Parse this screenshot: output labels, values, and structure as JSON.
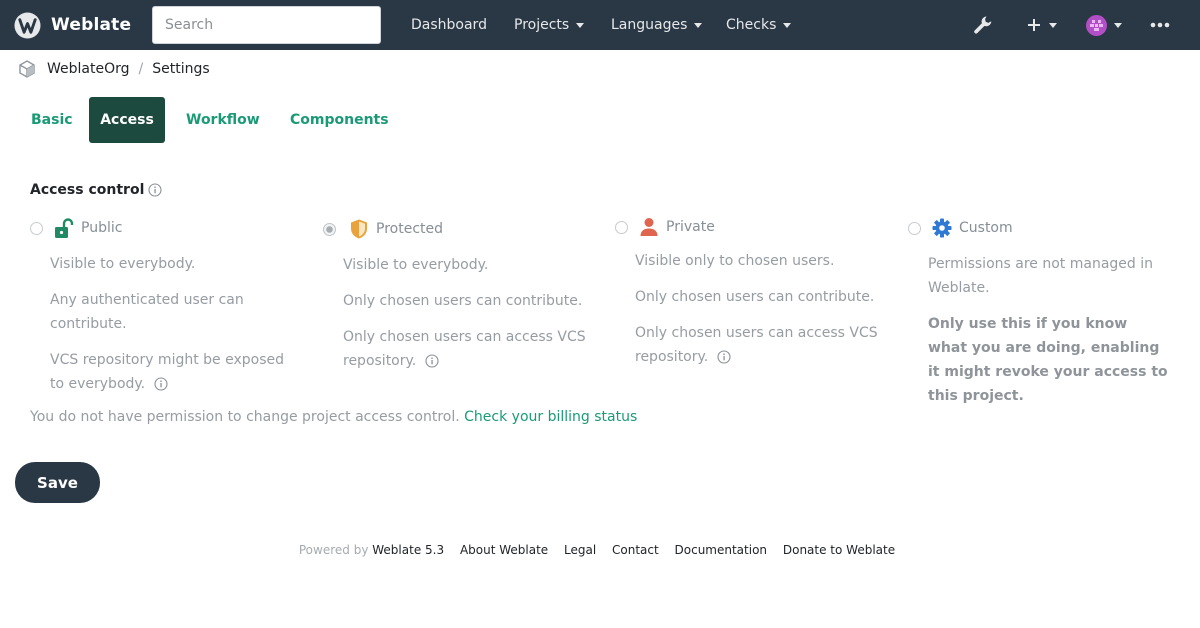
{
  "app": {
    "name": "Weblate"
  },
  "search": {
    "placeholder": "Search"
  },
  "nav": {
    "dashboard": "Dashboard",
    "projects": "Projects",
    "languages": "Languages",
    "checks": "Checks",
    "icons": {
      "tools": "wrench-icon",
      "add": "plus-icon",
      "user": "avatar-icon",
      "more": "ellipsis-icon"
    }
  },
  "breadcrumb": {
    "org": "WeblateOrg",
    "sep": "/",
    "page": "Settings"
  },
  "tabs": [
    {
      "label": "Basic",
      "active": false
    },
    {
      "label": "Access",
      "active": true
    },
    {
      "label": "Workflow",
      "active": false
    },
    {
      "label": "Components",
      "active": false
    }
  ],
  "access": {
    "title": "Access control",
    "options": [
      {
        "label": "Public",
        "icon": "unlocked-icon",
        "checked": false,
        "lines": [
          "Visible to everybody.",
          "Any authenticated user can contribute.",
          "VCS repository might be exposed to everybody."
        ]
      },
      {
        "label": "Protected",
        "icon": "shield-icon",
        "checked": true,
        "lines": [
          "Visible to everybody.",
          "Only chosen users can contribute.",
          "Only chosen users can access VCS repository."
        ]
      },
      {
        "label": "Private",
        "icon": "user-icon",
        "checked": false,
        "lines": [
          "Visible only to chosen users.",
          "Only chosen users can contribute.",
          "Only chosen users can access VCS repository."
        ]
      },
      {
        "label": "Custom",
        "icon": "gear-icon",
        "checked": false,
        "lines": [
          "Permissions are not managed in Weblate.",
          "Only use this if you know what you are doing, enabling it might revoke your access to this project."
        ]
      }
    ],
    "permission_note": "You do not have permission to change project access control.",
    "billing_link": "Check your billing status"
  },
  "save_label": "Save",
  "footer": {
    "powered_by": "Powered by",
    "version": "Weblate 5.3",
    "links": [
      "About Weblate",
      "Legal",
      "Contact",
      "Documentation",
      "Donate to Weblate"
    ]
  },
  "colors": {
    "navbar": "#2a3744",
    "accent": "#1a9a76",
    "active_tab": "#1c4a3e",
    "lock": "#1f8a63",
    "shield": "#e8a33d",
    "user": "#e0654f",
    "gear": "#2f7bd3"
  }
}
